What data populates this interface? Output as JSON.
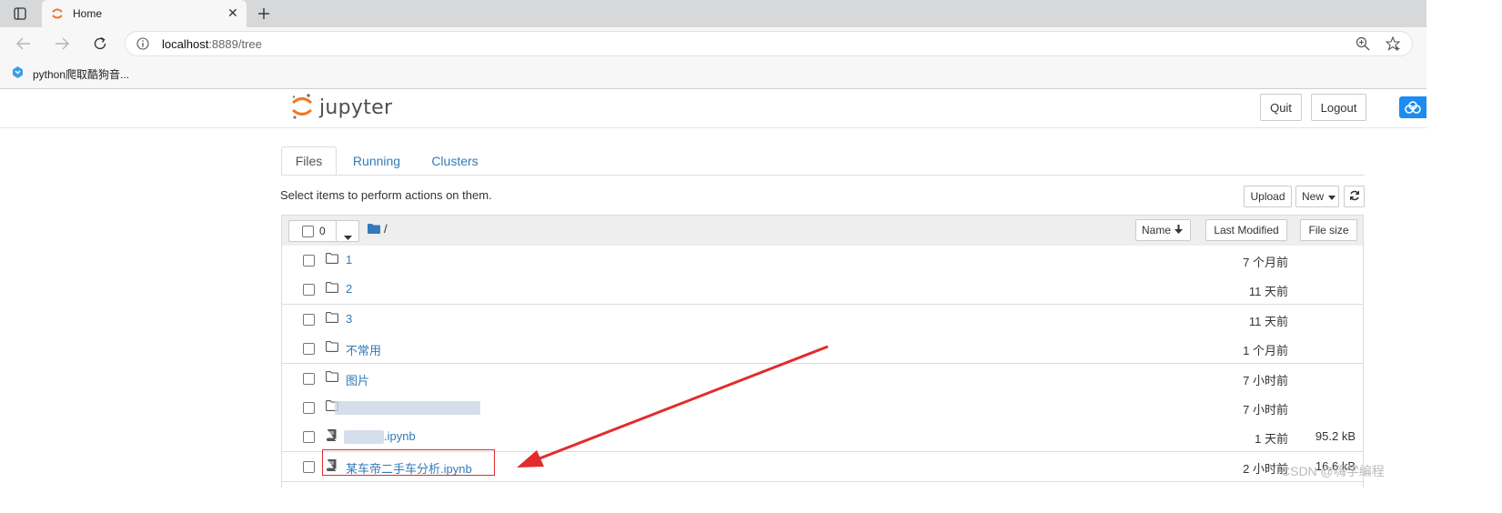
{
  "browser": {
    "tab_title": "Home",
    "url_host": "localhost",
    "url_rest": ":8889/tree",
    "bookmark_label": "python爬取酷狗音..."
  },
  "header": {
    "logo_text": "jupyter",
    "quit_label": "Quit",
    "logout_label": "Logout"
  },
  "tabs": [
    {
      "label": "Files",
      "active": true
    },
    {
      "label": "Running",
      "active": false
    },
    {
      "label": "Clusters",
      "active": false
    }
  ],
  "toolbar": {
    "instruction": "Select items to perform actions on them.",
    "upload_label": "Upload",
    "new_label": "New"
  },
  "list_header": {
    "selected_count": "0",
    "path": "/",
    "sort_name_label": "Name",
    "sort_modified_label": "Last Modified",
    "sort_size_label": "File size"
  },
  "rows": [
    {
      "type": "folder",
      "name": "1",
      "modified": "7 个月前",
      "size": ""
    },
    {
      "type": "folder",
      "name": "2",
      "modified": "11 天前",
      "size": ""
    },
    {
      "type": "folder",
      "name": "3",
      "modified": "11 天前",
      "size": ""
    },
    {
      "type": "folder",
      "name": "不常用",
      "modified": "1 个月前",
      "size": ""
    },
    {
      "type": "folder",
      "name": "图片",
      "modified": "7 小时前",
      "size": ""
    },
    {
      "type": "folder",
      "name": "",
      "modified": "7 小时前",
      "size": ""
    },
    {
      "type": "notebook",
      "name": ".ipynb",
      "modified": "1 天前",
      "size": "95.2 kB"
    },
    {
      "type": "notebook",
      "name": "某车帝二手车分析.ipynb",
      "modified": "2 小时前",
      "size": "16.6 kB"
    }
  ],
  "watermark": "CSDN @嗨学编程",
  "colors": {
    "link": "#337ab7",
    "annotation": "#e32b2b",
    "jupyter_orange": "#f37726"
  }
}
